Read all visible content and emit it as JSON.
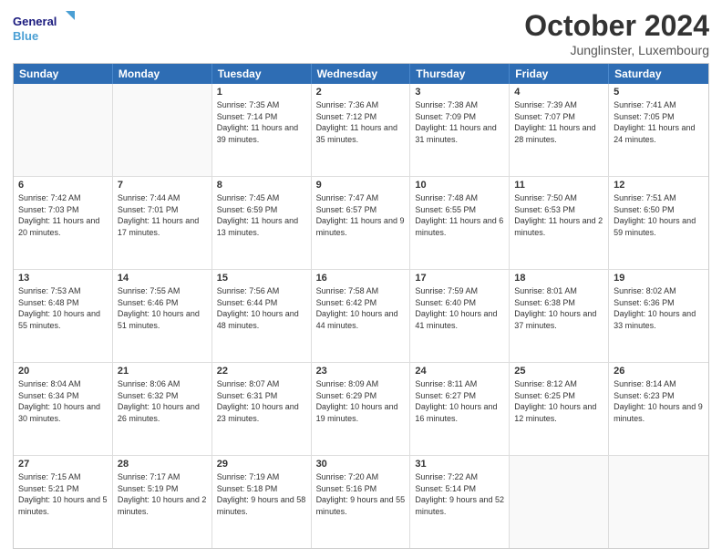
{
  "logo": {
    "line1": "General",
    "line2": "Blue"
  },
  "title": "October 2024",
  "location": "Junglinster, Luxembourg",
  "days": [
    "Sunday",
    "Monday",
    "Tuesday",
    "Wednesday",
    "Thursday",
    "Friday",
    "Saturday"
  ],
  "weeks": [
    [
      {
        "day": "",
        "content": ""
      },
      {
        "day": "",
        "content": ""
      },
      {
        "day": "1",
        "content": "Sunrise: 7:35 AM\nSunset: 7:14 PM\nDaylight: 11 hours and 39 minutes."
      },
      {
        "day": "2",
        "content": "Sunrise: 7:36 AM\nSunset: 7:12 PM\nDaylight: 11 hours and 35 minutes."
      },
      {
        "day": "3",
        "content": "Sunrise: 7:38 AM\nSunset: 7:09 PM\nDaylight: 11 hours and 31 minutes."
      },
      {
        "day": "4",
        "content": "Sunrise: 7:39 AM\nSunset: 7:07 PM\nDaylight: 11 hours and 28 minutes."
      },
      {
        "day": "5",
        "content": "Sunrise: 7:41 AM\nSunset: 7:05 PM\nDaylight: 11 hours and 24 minutes."
      }
    ],
    [
      {
        "day": "6",
        "content": "Sunrise: 7:42 AM\nSunset: 7:03 PM\nDaylight: 11 hours and 20 minutes."
      },
      {
        "day": "7",
        "content": "Sunrise: 7:44 AM\nSunset: 7:01 PM\nDaylight: 11 hours and 17 minutes."
      },
      {
        "day": "8",
        "content": "Sunrise: 7:45 AM\nSunset: 6:59 PM\nDaylight: 11 hours and 13 minutes."
      },
      {
        "day": "9",
        "content": "Sunrise: 7:47 AM\nSunset: 6:57 PM\nDaylight: 11 hours and 9 minutes."
      },
      {
        "day": "10",
        "content": "Sunrise: 7:48 AM\nSunset: 6:55 PM\nDaylight: 11 hours and 6 minutes."
      },
      {
        "day": "11",
        "content": "Sunrise: 7:50 AM\nSunset: 6:53 PM\nDaylight: 11 hours and 2 minutes."
      },
      {
        "day": "12",
        "content": "Sunrise: 7:51 AM\nSunset: 6:50 PM\nDaylight: 10 hours and 59 minutes."
      }
    ],
    [
      {
        "day": "13",
        "content": "Sunrise: 7:53 AM\nSunset: 6:48 PM\nDaylight: 10 hours and 55 minutes."
      },
      {
        "day": "14",
        "content": "Sunrise: 7:55 AM\nSunset: 6:46 PM\nDaylight: 10 hours and 51 minutes."
      },
      {
        "day": "15",
        "content": "Sunrise: 7:56 AM\nSunset: 6:44 PM\nDaylight: 10 hours and 48 minutes."
      },
      {
        "day": "16",
        "content": "Sunrise: 7:58 AM\nSunset: 6:42 PM\nDaylight: 10 hours and 44 minutes."
      },
      {
        "day": "17",
        "content": "Sunrise: 7:59 AM\nSunset: 6:40 PM\nDaylight: 10 hours and 41 minutes."
      },
      {
        "day": "18",
        "content": "Sunrise: 8:01 AM\nSunset: 6:38 PM\nDaylight: 10 hours and 37 minutes."
      },
      {
        "day": "19",
        "content": "Sunrise: 8:02 AM\nSunset: 6:36 PM\nDaylight: 10 hours and 33 minutes."
      }
    ],
    [
      {
        "day": "20",
        "content": "Sunrise: 8:04 AM\nSunset: 6:34 PM\nDaylight: 10 hours and 30 minutes."
      },
      {
        "day": "21",
        "content": "Sunrise: 8:06 AM\nSunset: 6:32 PM\nDaylight: 10 hours and 26 minutes."
      },
      {
        "day": "22",
        "content": "Sunrise: 8:07 AM\nSunset: 6:31 PM\nDaylight: 10 hours and 23 minutes."
      },
      {
        "day": "23",
        "content": "Sunrise: 8:09 AM\nSunset: 6:29 PM\nDaylight: 10 hours and 19 minutes."
      },
      {
        "day": "24",
        "content": "Sunrise: 8:11 AM\nSunset: 6:27 PM\nDaylight: 10 hours and 16 minutes."
      },
      {
        "day": "25",
        "content": "Sunrise: 8:12 AM\nSunset: 6:25 PM\nDaylight: 10 hours and 12 minutes."
      },
      {
        "day": "26",
        "content": "Sunrise: 8:14 AM\nSunset: 6:23 PM\nDaylight: 10 hours and 9 minutes."
      }
    ],
    [
      {
        "day": "27",
        "content": "Sunrise: 7:15 AM\nSunset: 5:21 PM\nDaylight: 10 hours and 5 minutes."
      },
      {
        "day": "28",
        "content": "Sunrise: 7:17 AM\nSunset: 5:19 PM\nDaylight: 10 hours and 2 minutes."
      },
      {
        "day": "29",
        "content": "Sunrise: 7:19 AM\nSunset: 5:18 PM\nDaylight: 9 hours and 58 minutes."
      },
      {
        "day": "30",
        "content": "Sunrise: 7:20 AM\nSunset: 5:16 PM\nDaylight: 9 hours and 55 minutes."
      },
      {
        "day": "31",
        "content": "Sunrise: 7:22 AM\nSunset: 5:14 PM\nDaylight: 9 hours and 52 minutes."
      },
      {
        "day": "",
        "content": ""
      },
      {
        "day": "",
        "content": ""
      }
    ]
  ]
}
